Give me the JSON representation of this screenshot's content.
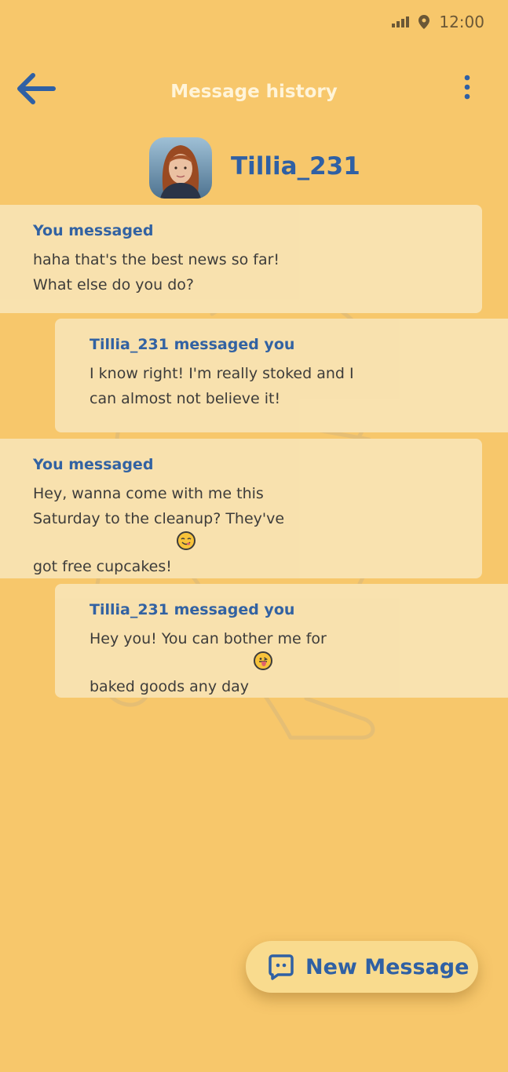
{
  "status_bar": {
    "time": "12:00",
    "icons": [
      "signal-icon",
      "location-icon"
    ]
  },
  "header": {
    "title": "Message history",
    "back_icon": "arrow-left-icon",
    "menu_icon": "more-vertical-icon"
  },
  "contact": {
    "name": "Tillia_231"
  },
  "messages": [
    {
      "sender": "You messaged",
      "text": "haha that's the best news so far!\nWhat else do you do?"
    },
    {
      "sender": "Tillia_231 messaged you",
      "text": "I know right! I'm really stoked and I\ncan almost not believe it!"
    },
    {
      "sender": "You messaged",
      "text": "Hey, wanna come with me this\nSaturday to the cleanup? They've\ngot free cupcakes!",
      "emoji": "smiling-face-savoring-food"
    },
    {
      "sender": "Tillia_231 messaged you",
      "text": "Hey you! You can bother me for\nbaked goods any day",
      "emoji": "face-with-tongue"
    }
  ],
  "fab": {
    "label": "New Message",
    "icon": "chat-dots-icon"
  },
  "colors": {
    "background": "#F7C76B",
    "accent": "#2F60A4",
    "card": "#F9E2B0"
  }
}
